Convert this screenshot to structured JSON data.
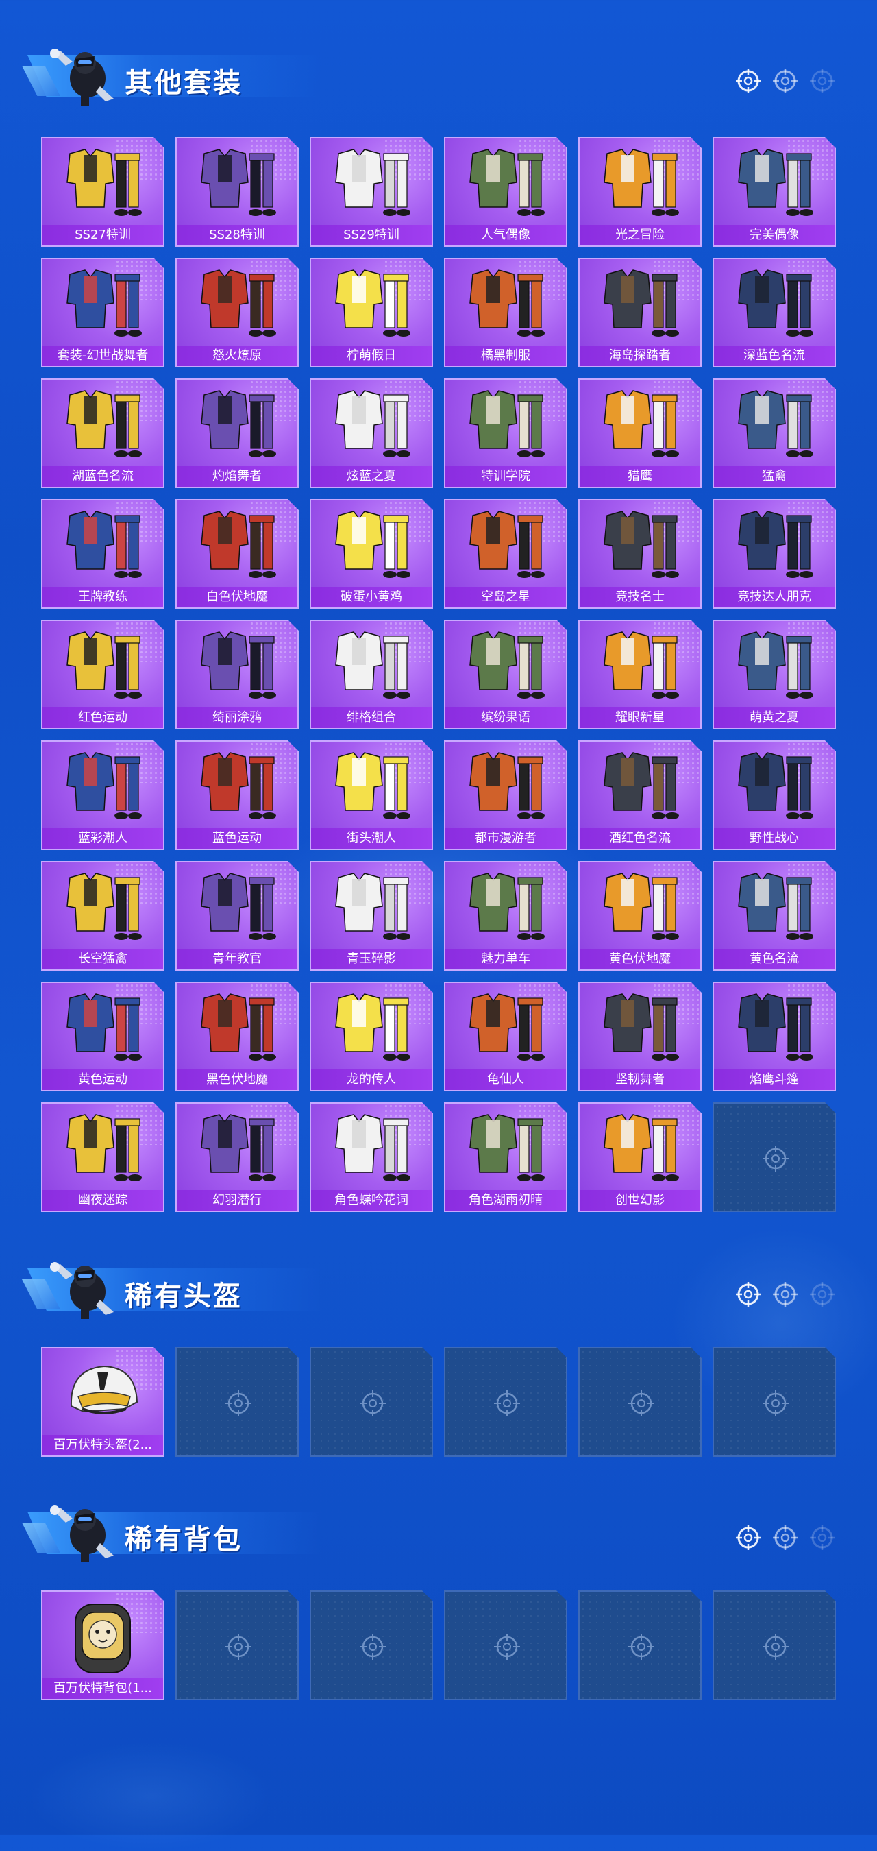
{
  "colors": {
    "background": "#1257d4",
    "tile_fill": "#a55df0",
    "label_bar": "#8b2de0",
    "empty_tile": "#1f4c8e"
  },
  "sections": [
    {
      "title": "其他套装",
      "items": [
        {
          "label": "SS27特训",
          "art": "outfit-yellow-black"
        },
        {
          "label": "SS28特训",
          "art": "outfit-purple-black"
        },
        {
          "label": "SS29特训",
          "art": "outfit-white"
        },
        {
          "label": "人气偶像",
          "art": "outfit-green-camo"
        },
        {
          "label": "光之冒险",
          "art": "outfit-orange-white"
        },
        {
          "label": "完美偶像",
          "art": "outfit-blue-jeans"
        },
        {
          "label": "套装-幻世战舞者",
          "art": "outfit-blue-hood"
        },
        {
          "label": "怒火燎原",
          "art": "outfit-red-jacket"
        },
        {
          "label": "柠萌假日",
          "art": "outfit-yellow-dress"
        },
        {
          "label": "橘黑制服",
          "art": "outfit-orange-black"
        },
        {
          "label": "海岛探踏者",
          "art": "outfit-dark-vest"
        },
        {
          "label": "深蓝色名流",
          "art": "outfit-navy-suit"
        },
        {
          "label": "湖蓝色名流",
          "art": "outfit-teal-suit"
        },
        {
          "label": "灼焰舞者",
          "art": "outfit-red-black"
        },
        {
          "label": "炫蓝之夏",
          "art": "outfit-cyan-black"
        },
        {
          "label": "特训学院",
          "art": "outfit-school"
        },
        {
          "label": "猎鹰",
          "art": "outfit-khaki-jacket"
        },
        {
          "label": "猛禽",
          "art": "outfit-brown-hood"
        },
        {
          "label": "王牌教练",
          "art": "outfit-orange-top"
        },
        {
          "label": "白色伏地魔",
          "art": "outfit-white-hood"
        },
        {
          "label": "破蛋小黄鸡",
          "art": "outfit-chick"
        },
        {
          "label": "空岛之星",
          "art": "outfit-cyber-pink"
        },
        {
          "label": "竞技名士",
          "art": "outfit-white-blue"
        },
        {
          "label": "竞技达人朋克",
          "art": "outfit-red-punk"
        },
        {
          "label": "红色运动",
          "art": "outfit-pink-sport"
        },
        {
          "label": "绮丽涂鸦",
          "art": "outfit-graffiti"
        },
        {
          "label": "绯格组合",
          "art": "outfit-red-plaid"
        },
        {
          "label": "缤纷果语",
          "art": "outfit-fruit"
        },
        {
          "label": "耀眼新星",
          "art": "outfit-white-shirt"
        },
        {
          "label": "萌黄之夏",
          "art": "outfit-yellow-summer"
        },
        {
          "label": "蓝彩潮人",
          "art": "outfit-black-street"
        },
        {
          "label": "蓝色运动",
          "art": "outfit-blue-sport"
        },
        {
          "label": "街头潮人",
          "art": "outfit-red-puffer"
        },
        {
          "label": "都市漫游者",
          "art": "outfit-green-hood"
        },
        {
          "label": "酒红色名流",
          "art": "outfit-wine-suit"
        },
        {
          "label": "野性战心",
          "art": "outfit-orange-vest"
        },
        {
          "label": "长空猛禽",
          "art": "outfit-grey-camo"
        },
        {
          "label": "青年教官",
          "art": "outfit-beige-shirt"
        },
        {
          "label": "青玉碎影",
          "art": "outfit-green-floral"
        },
        {
          "label": "魅力单车",
          "art": "outfit-yellow-tee"
        },
        {
          "label": "黄色伏地魔",
          "art": "outfit-yellow-hood"
        },
        {
          "label": "黄色名流",
          "art": "outfit-yellow-suit"
        },
        {
          "label": "黄色运动",
          "art": "outfit-yellow-sport"
        },
        {
          "label": "黑色伏地魔",
          "art": "outfit-black-hood"
        },
        {
          "label": "龙的传人",
          "art": "outfit-qipao"
        },
        {
          "label": "龟仙人",
          "art": "outfit-hawaii"
        },
        {
          "label": "坚韧舞者",
          "art": "outfit-white-dancer"
        },
        {
          "label": "焰鹰斗篷",
          "art": "outfit-red-cloak"
        },
        {
          "label": "幽夜迷踪",
          "art": "outfit-dark-ninja"
        },
        {
          "label": "幻羽潜行",
          "art": "outfit-green-ninja"
        },
        {
          "label": "角色蝶吟花词",
          "art": "character-pink"
        },
        {
          "label": "角色湖雨初晴",
          "art": "character-teal"
        },
        {
          "label": "创世幻影",
          "art": "outfit-armor-blue"
        },
        {
          "label": "",
          "art": "empty"
        }
      ]
    },
    {
      "title": "稀有头盔",
      "items": [
        {
          "label": "百万伏特头盔(2...",
          "art": "helmet"
        },
        {
          "label": "",
          "art": "empty"
        },
        {
          "label": "",
          "art": "empty"
        },
        {
          "label": "",
          "art": "empty"
        },
        {
          "label": "",
          "art": "empty"
        },
        {
          "label": "",
          "art": "empty"
        }
      ]
    },
    {
      "title": "稀有背包",
      "items": [
        {
          "label": "百万伏特背包(1...",
          "art": "backpack"
        },
        {
          "label": "",
          "art": "empty"
        },
        {
          "label": "",
          "art": "empty"
        },
        {
          "label": "",
          "art": "empty"
        },
        {
          "label": "",
          "art": "empty"
        },
        {
          "label": "",
          "art": "empty"
        }
      ]
    }
  ]
}
